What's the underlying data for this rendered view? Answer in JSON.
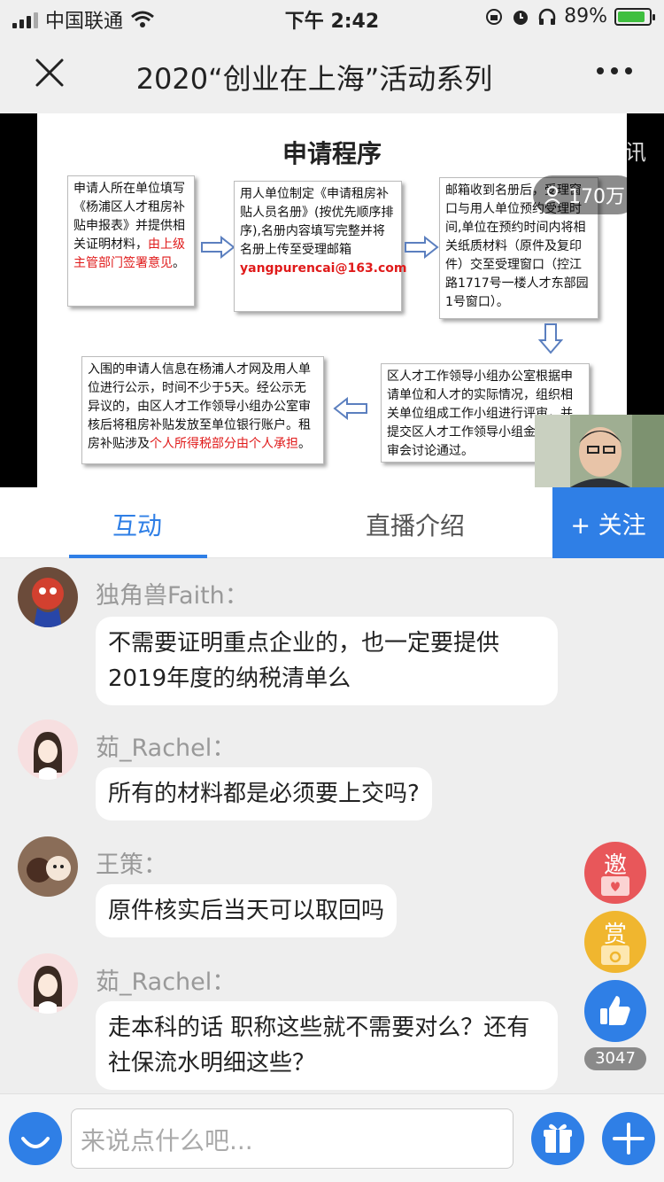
{
  "status_bar": {
    "carrier": "中国联通",
    "time": "下午 2:42",
    "battery": "89%",
    "battery_level": 0.89
  },
  "nav": {
    "title": "2020“创业在上海”活动系列"
  },
  "video": {
    "slide_title": "申请程序",
    "step1_text": "申请人所在单位填写《杨浦区人才租房补贴申报表》并提供相关证明材料，",
    "step1_red": "由上级主管部门签署意见",
    "step1_end": "。",
    "step2_text": "用人单位制定《申请租房补贴人员名册》(按优先顺序排序),名册内容填写完整并将名册上传至受理邮箱",
    "step2_email": "yangpurencai@163.com",
    "step3_text": "邮箱收到名册后，受理窗口与用人单位预约受理时间,单位在预约时间内将相关纸质材料（原件及复印件）交至受理窗口（控江路1717号一楼人才东部园1号窗口）。",
    "step4_text": "区人才工作领导小组办公室根据申请单位和人才的实际情况，组织相关单位组成工作小组进行评审，并提交区人才工作领导小组金拨付联审会讨论通过。",
    "step5_text": "入围的申请人信息在杨浦人才网及用人单位进行公示，时间不少于5天。经公示无异议的，由区人才工作领导小组办公室审核后将租房补贴发放至单位银行账户。租房补贴涉及",
    "step5_red": "个人所得税部分由个人承担",
    "step5_end": "。",
    "watermark": "中企视讯",
    "viewers": "170万"
  },
  "tabs": {
    "interaction": "互动",
    "intro": "直播介绍",
    "follow": "+ 关注"
  },
  "messages": [
    {
      "user": "独角兽Faith：",
      "text": "不需要证明重点企业的，也一定要提供2019年度的纳税清单么"
    },
    {
      "user": "茹_Rachel：",
      "text": "所有的材料都是必须要上交吗?"
    },
    {
      "user": "王策：",
      "text": "原件核实后当天可以取回吗"
    },
    {
      "user": "茹_Rachel：",
      "text": "走本科的话 职称这些就不需要对么？还有社保流水明细这些？"
    }
  ],
  "floating": {
    "invite": "邀",
    "reward": "赏",
    "likes": "3047"
  },
  "input": {
    "placeholder": "来说点什么吧..."
  },
  "colors": {
    "accent": "#2f7fe6",
    "red": "#e01a1a"
  }
}
